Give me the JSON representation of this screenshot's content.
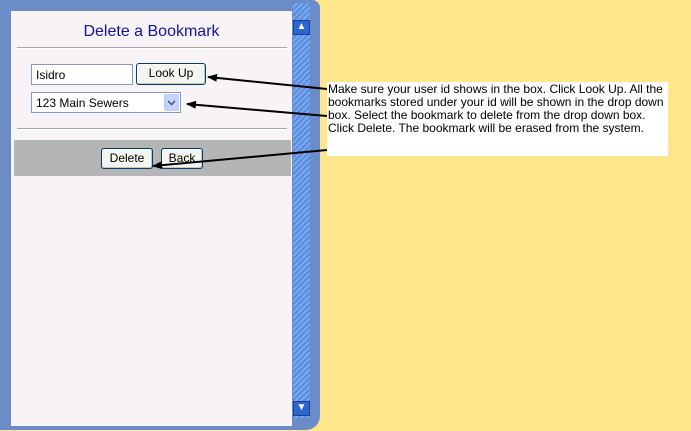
{
  "window": {
    "title": "Delete a Bookmark",
    "close_glyph": "x",
    "icons": [
      "close-icon",
      "scroll-up-icon",
      "scroll-down-icon",
      "chevron-down-icon"
    ]
  },
  "form": {
    "userid_value": "Isidro",
    "lookup_label": "Look Up",
    "bookmark_selected": "123 Main Sewers",
    "delete_label": "Delete",
    "back_label": "Back"
  },
  "annotation": {
    "text": "Make sure your user id shows in the box.  Click Look Up.  All the bookmarks stored under your id will be shown in the drop down box. Select the bookmark to delete from the drop down box.  Click Delete.  The bookmark will be erased from the system."
  },
  "colors": {
    "background": "#FFE68C",
    "window_frame": "#6B8CC6",
    "title_text": "#1414A8"
  }
}
